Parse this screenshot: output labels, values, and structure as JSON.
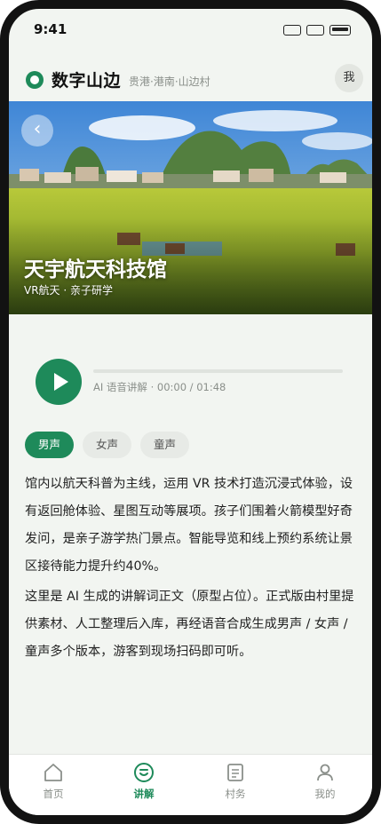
{
  "status": {
    "time": "9:41"
  },
  "header": {
    "title": "数字山边",
    "location": "贵港·港南·山边村",
    "avatar": "我"
  },
  "hero": {
    "back_icon": "‹",
    "title": "天宇航天科技馆",
    "subtitle": "VR航天 · 亲子研学"
  },
  "player": {
    "text": "AI 语音讲解 · 00:00 / 01:48",
    "progress": 0
  },
  "voices": [
    {
      "label": "男声",
      "active": true
    },
    {
      "label": "女声",
      "active": false
    },
    {
      "label": "童声",
      "active": false
    }
  ],
  "body": {
    "para1": "馆内以航天科普为主线，运用 VR 技术打造沉浸式体验，设有返回舱体验、星图互动等展项。孩子们围着火箭模型好奇发问，是亲子游学热门景点。智能导览和线上预约系统让景区接待能力提升约40%。",
    "para2": "这里是 AI 生成的讲解词正文（原型占位）。正式版由村里提供素材、人工整理后入库，再经语音合成生成男声 / 女声 / 童声多个版本，游客到现场扫码即可听。"
  },
  "tabs": [
    {
      "label": "首页",
      "icon": "home-icon",
      "active": false
    },
    {
      "label": "讲解",
      "icon": "audio-guide-icon",
      "active": true
    },
    {
      "label": "村务",
      "icon": "document-icon",
      "active": false
    },
    {
      "label": "我的",
      "icon": "user-icon",
      "active": false
    }
  ],
  "colors": {
    "accent": "#1e8a5a",
    "background": "#f2f5f1"
  }
}
